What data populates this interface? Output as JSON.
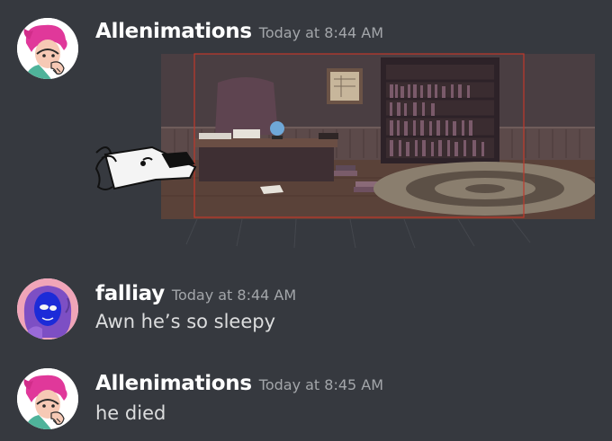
{
  "messages": [
    {
      "username": "Allenimations",
      "timestamp": "Today at 8:44 AM",
      "avatar_icon": "pink-hair-character-avatar",
      "attachment": "office-scene-drawing"
    },
    {
      "username": "falliay",
      "timestamp": "Today at 8:44 AM",
      "avatar_icon": "blue-face-character-avatar",
      "text": "Awn he’s so sleepy"
    },
    {
      "username": "Allenimations",
      "timestamp": "Today at 8:45 AM",
      "avatar_icon": "pink-hair-character-avatar",
      "text": "he died"
    }
  ],
  "colors": {
    "background": "#36393f",
    "username": "#ffffff",
    "timestamp": "#a3a6aa",
    "message_text": "#dcddde"
  }
}
